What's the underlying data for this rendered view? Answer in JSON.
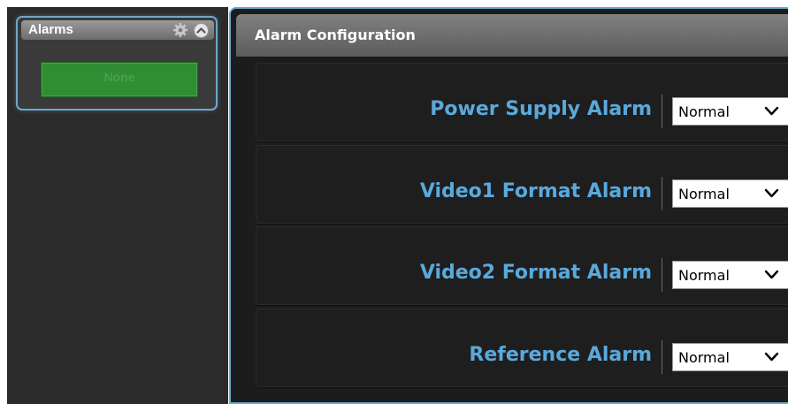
{
  "sidebar": {
    "alarm_widget": {
      "title": "Alarms",
      "status_text": "None",
      "gear_icon": "gear-icon",
      "collapse_icon": "chevron-up-circle-icon"
    }
  },
  "main": {
    "header": {
      "title": "Alarm Configuration"
    },
    "alarms": [
      {
        "label": "Power Supply Alarm",
        "value": "Normal"
      },
      {
        "label": "Video1 Format Alarm",
        "value": "Normal"
      },
      {
        "label": "Video2 Format Alarm",
        "value": "Normal"
      },
      {
        "label": "Reference Alarm",
        "value": "Normal"
      }
    ]
  },
  "colors": {
    "panel_border": "#6aa9c9",
    "label_blue": "#5aa9dc",
    "status_green": "#2f8d33",
    "panel_background": "#1c1c1c"
  }
}
